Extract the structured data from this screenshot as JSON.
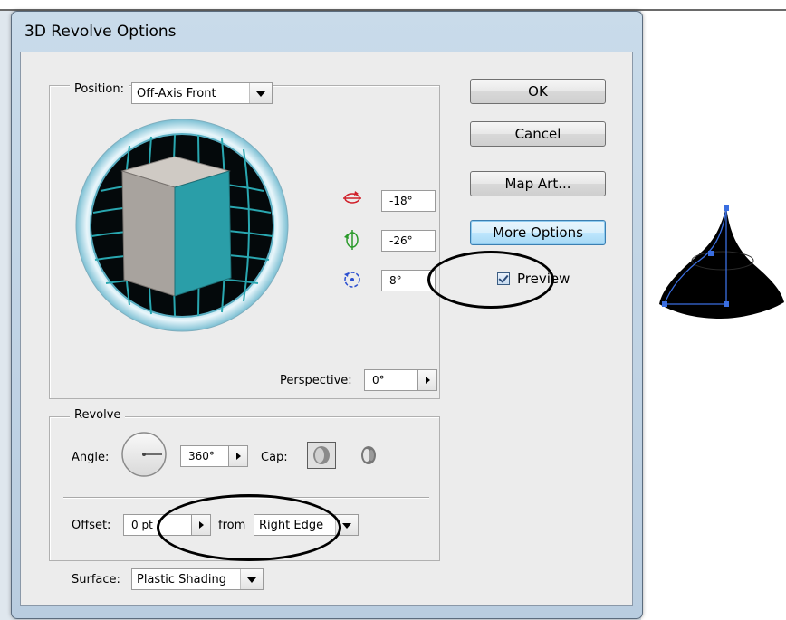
{
  "dialog": {
    "title": "3D Revolve Options"
  },
  "position": {
    "label": "Position:",
    "selected": "Off-Axis Front",
    "rotation_x": "-18°",
    "rotation_y": "-26°",
    "rotation_z": "8°",
    "perspective_label": "Perspective:",
    "perspective_value": "0°"
  },
  "buttons": {
    "ok": "OK",
    "cancel": "Cancel",
    "map_art": "Map Art...",
    "more_options": "More Options"
  },
  "preview": {
    "label": "Preview",
    "checked": true
  },
  "revolve": {
    "legend": "Revolve",
    "angle_label": "Angle:",
    "angle_value": "360°",
    "cap_label": "Cap:",
    "offset_label": "Offset:",
    "offset_value": "0 pt",
    "from_label": "from",
    "from_selected": "Right Edge"
  },
  "surface": {
    "label": "Surface:",
    "selected": "Plastic Shading"
  },
  "colors": {
    "cube_front": "#2a9ea8",
    "cube_top": "#cfcac4",
    "cube_side": "#a8a39e",
    "grid": "#29a7b0",
    "rotation_x_icon": "#d0202a",
    "rotation_y_icon": "#2a9a2a",
    "rotation_z_icon": "#2a4ed0",
    "selection_path": "#3a6ee0"
  }
}
